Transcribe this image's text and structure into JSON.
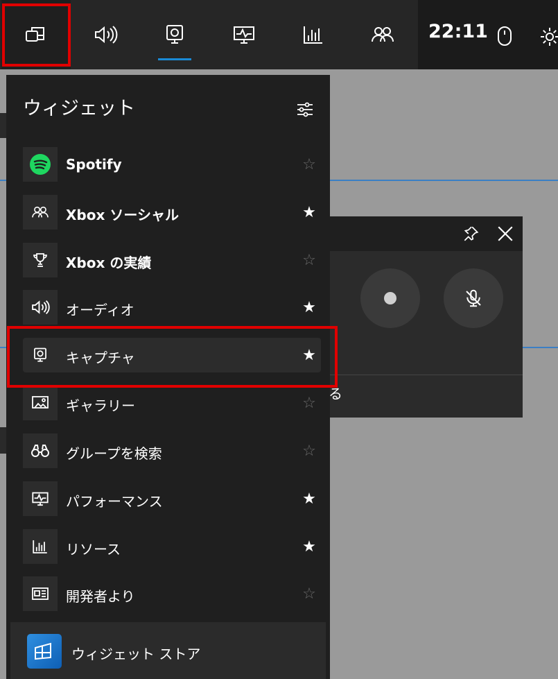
{
  "topbar": {
    "clock": "22:11",
    "buttons": [
      {
        "name": "widget-menu",
        "icon": "widget-menu-icon"
      },
      {
        "name": "audio",
        "icon": "speaker-icon"
      },
      {
        "name": "capture",
        "icon": "webcam-icon"
      },
      {
        "name": "performance",
        "icon": "monitor-pulse-icon"
      },
      {
        "name": "resources",
        "icon": "bar-chart-icon"
      },
      {
        "name": "xbox-social",
        "icon": "people-icon"
      }
    ]
  },
  "menu": {
    "title": "ウィジェット",
    "items": [
      {
        "label": "Spotify",
        "icon": "spotify-icon",
        "favorite": false
      },
      {
        "label": "Xbox ソーシャル",
        "icon": "people-icon",
        "favorite": true
      },
      {
        "label": "Xbox の実績",
        "icon": "trophy-icon",
        "favorite": false
      },
      {
        "label": "オーディオ",
        "icon": "speaker-icon",
        "favorite": true
      },
      {
        "label": "キャプチャ",
        "icon": "webcam-icon",
        "favorite": true
      },
      {
        "label": "ギャラリー",
        "icon": "gallery-icon",
        "favorite": false
      },
      {
        "label": "グループを検索",
        "icon": "binoculars-icon",
        "favorite": false
      },
      {
        "label": "パフォーマンス",
        "icon": "monitor-pulse-icon",
        "favorite": true
      },
      {
        "label": "リソース",
        "icon": "bar-chart-icon",
        "favorite": true
      },
      {
        "label": "開発者より",
        "icon": "news-icon",
        "favorite": false
      }
    ],
    "star_on": "★",
    "star_off": "☆"
  },
  "store": {
    "label": "ウィジェット ストア"
  },
  "capture_widget": {
    "partial_text": "る"
  },
  "colors": {
    "accent": "#1a8ad6",
    "highlight_box": "#e00000",
    "spotify": "#1ed760"
  }
}
